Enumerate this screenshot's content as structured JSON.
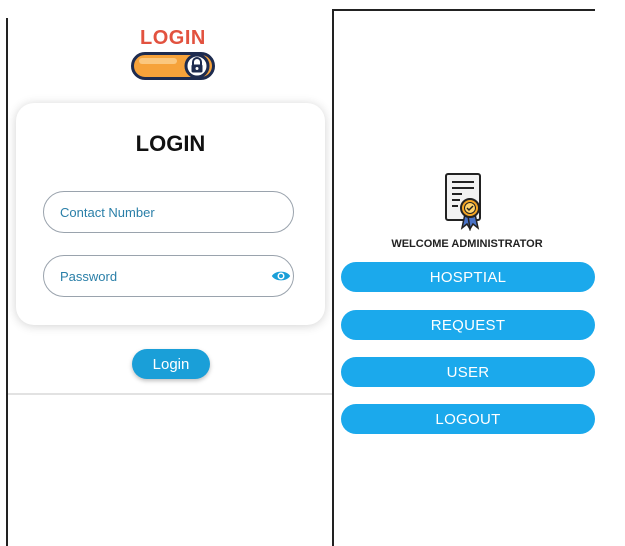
{
  "login_screen": {
    "logo_text": "LOGIN",
    "card_title": "LOGIN",
    "contact_placeholder": "Contact Number",
    "password_placeholder": "Password",
    "login_button": "Login"
  },
  "admin_screen": {
    "welcome_text": "WELCOME ADMINISTRATOR",
    "menu": [
      "HOSPTIAL",
      "REQUEST",
      "USER",
      "LOGOUT"
    ]
  },
  "colors": {
    "accent": "#1ba9ec",
    "logo_red": "#e2523f",
    "logo_orange": "#f6a23a",
    "logo_navy": "#1d2b4f"
  },
  "icons": [
    "lock-icon",
    "eye-icon",
    "certificate-document-icon"
  ]
}
